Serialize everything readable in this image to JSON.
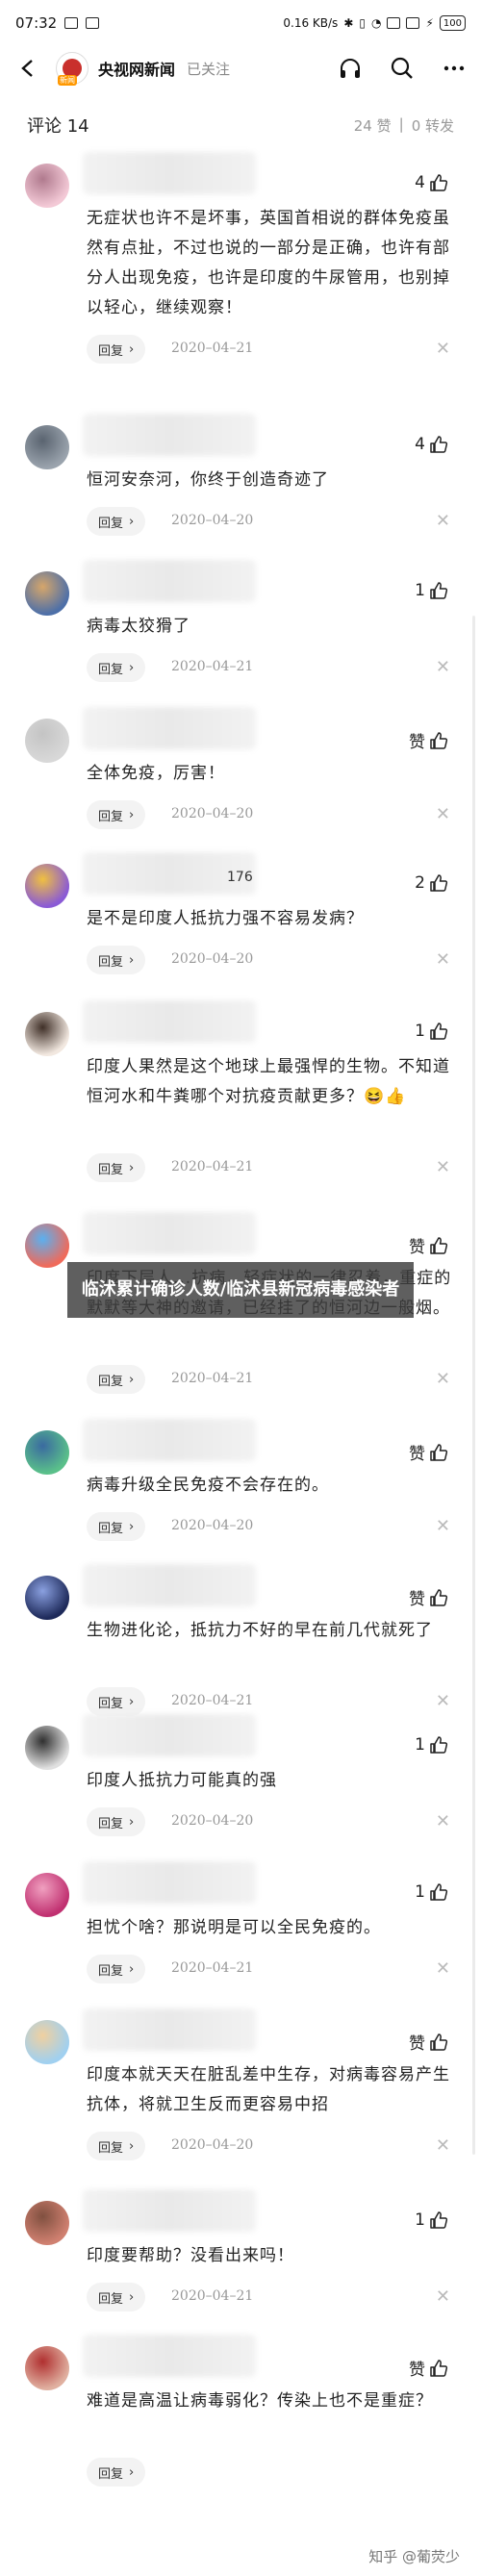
{
  "status": {
    "time": "07:32",
    "speed": "0.16 KB/s",
    "battery": "100"
  },
  "header": {
    "source_name": "央视网新闻",
    "follow_state": "已关注",
    "logo_tag": "新闻"
  },
  "comment_bar": {
    "title": "评论 14",
    "likes": "24 赞",
    "sep": "|",
    "shares": "0 转发"
  },
  "overlay": {
    "text": "临沭累计确诊人数/临沭县新冠病毒感染者"
  },
  "watermark": "知乎 @葡荧少",
  "comments": [
    {
      "likes": "4",
      "text": "无症状也许不是坏事，英国首相说的群体免疫虽然有点扯，不过也说的一部分是正确，也许有部分人出现免疫，也许是印度的牛尿管用，也别掉以轻心，继续观察！",
      "reply": "回复",
      "date": "2020–04–21"
    },
    {
      "likes": "4",
      "text": "恒河安奈河，你终于创造奇迹了",
      "reply": "回复",
      "date": "2020–04–20"
    },
    {
      "likes": "1",
      "text": "病毒太狡猾了",
      "reply": "回复",
      "date": "2020–04–21"
    },
    {
      "likes": "赞",
      "text": "全体免疫，厉害！",
      "reply": "回复",
      "date": "2020–04–20"
    },
    {
      "likes": "2",
      "nick_fragment": "176",
      "text": "是不是印度人抵抗力强不容易发病？",
      "reply": "回复",
      "date": "2020–04–20"
    },
    {
      "likes": "1",
      "text": "印度人果然是这个地球上最强悍的生物。不知道恒河水和牛粪哪个对抗疫贡献更多？😆👍",
      "reply": "回复",
      "date": "2020–04–21"
    },
    {
      "likes": "赞",
      "text": "印度下层人...抗病，轻症状的一律忍着，重症的默默等大神的邀请，已经挂了的恒河边一般烟。",
      "reply": "回复",
      "date": "2020–04–21"
    },
    {
      "likes": "赞",
      "text": "病毒升级全民免疫不会存在的。",
      "reply": "回复",
      "date": "2020–04–20"
    },
    {
      "likes": "赞",
      "text": "生物进化论，抵抗力不好的早在前几代就死了",
      "reply": "回复",
      "date": "2020–04–21"
    },
    {
      "likes": "1",
      "text": "印度人抵抗力可能真的强",
      "reply": "回复",
      "date": "2020–04–20"
    },
    {
      "likes": "1",
      "text": "担忧个啥？那说明是可以全民免疫的。",
      "reply": "回复",
      "date": "2020–04–21"
    },
    {
      "likes": "赞",
      "text": "印度本就天天在脏乱差中生存，对病毒容易产生抗体，将就卫生反而更容易中招",
      "reply": "回复",
      "date": "2020–04–20"
    },
    {
      "likes": "1",
      "text": "印度要帮助？没看出来吗！",
      "reply": "回复",
      "date": "2020–04–21"
    },
    {
      "likes": "赞",
      "text": "难道是高温让病毒弱化？传染上也不是重症？",
      "reply": "回复",
      "date": ""
    }
  ]
}
